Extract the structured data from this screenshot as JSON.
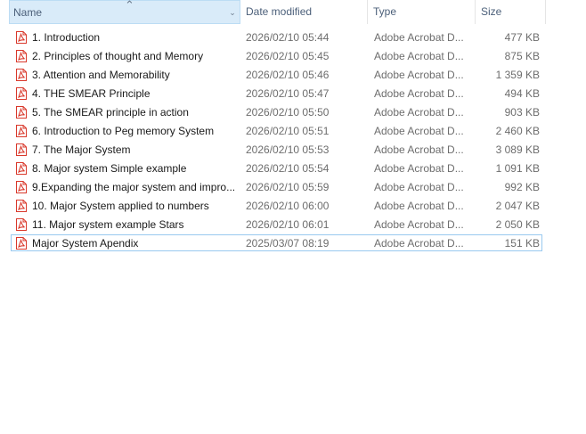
{
  "columns": {
    "name": "Name",
    "date": "Date modified",
    "type": "Type",
    "size": "Size"
  },
  "icons": {
    "sort": "sort-ascending-icon",
    "dropdown": "chevron-down-icon",
    "file": "pdf-file-icon"
  },
  "colors": {
    "pdf_red": "#d9382b",
    "header_selected": "#d9ebf9",
    "selection_border": "#99c9ef"
  },
  "files": [
    {
      "name": "1. Introduction",
      "date": "2026/02/10 05:44",
      "type": "Adobe Acrobat D...",
      "size": "477 KB"
    },
    {
      "name": "2. Principles of thought and Memory",
      "date": "2026/02/10 05:45",
      "type": "Adobe Acrobat D...",
      "size": "875 KB"
    },
    {
      "name": "3. Attention and Memorability",
      "date": "2026/02/10 05:46",
      "type": "Adobe Acrobat D...",
      "size": "1 359 KB"
    },
    {
      "name": "4. THE SMEAR Principle",
      "date": "2026/02/10 05:47",
      "type": "Adobe Acrobat D...",
      "size": "494 KB"
    },
    {
      "name": "5. The SMEAR principle in action",
      "date": "2026/02/10 05:50",
      "type": "Adobe Acrobat D...",
      "size": "903 KB"
    },
    {
      "name": "6. Introduction to Peg memory System",
      "date": "2026/02/10 05:51",
      "type": "Adobe Acrobat D...",
      "size": "2 460 KB"
    },
    {
      "name": "7. The Major System",
      "date": "2026/02/10 05:53",
      "type": "Adobe Acrobat D...",
      "size": "3 089 KB"
    },
    {
      "name": "8. Major system Simple example",
      "date": "2026/02/10 05:54",
      "type": "Adobe Acrobat D...",
      "size": "1 091 KB"
    },
    {
      "name": "9.Expanding the major system and impro...",
      "date": "2026/02/10 05:59",
      "type": "Adobe Acrobat D...",
      "size": "992 KB"
    },
    {
      "name": "10. Major System applied to numbers",
      "date": "2026/02/10 06:00",
      "type": "Adobe Acrobat D...",
      "size": "2 047 KB"
    },
    {
      "name": "11. Major system example Stars",
      "date": "2026/02/10 06:01",
      "type": "Adobe Acrobat D...",
      "size": "2 050 KB"
    },
    {
      "name": "Major System Apendix",
      "date": "2025/03/07 08:19",
      "type": "Adobe Acrobat D...",
      "size": "151 KB",
      "selected": true
    }
  ]
}
